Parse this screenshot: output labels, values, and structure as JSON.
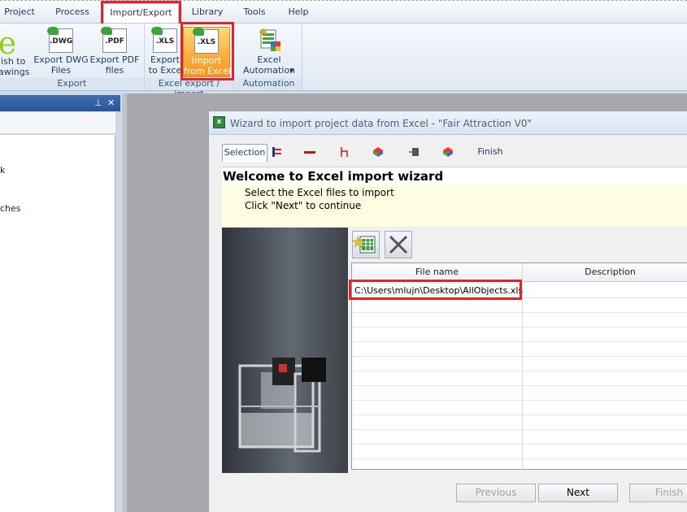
{
  "menu": {
    "items": [
      "Project",
      "Process",
      "Import/Export",
      "Library",
      "Tools",
      "Help"
    ],
    "active": "Import/Export"
  },
  "ribbon": {
    "groups": {
      "export": {
        "label": "Export",
        "publish": "lish to\nawings",
        "dwg": {
          "label": "Export DWG\nFiles",
          "icon_text": ".DWG"
        },
        "pdf": {
          "label": "Export PDF\nfiles",
          "icon_text": ".PDF"
        }
      },
      "excel": {
        "label": "Excel export / import",
        "export_excel": {
          "label": "Export\nto Exce",
          "icon_text": ".XLS"
        },
        "import_excel": {
          "label": "Import\nfrom Excel",
          "icon_text": ".XLS"
        }
      },
      "automation": {
        "label": "Automation",
        "excel_automation": {
          "label": "Excel\nAutomation"
        }
      }
    }
  },
  "left_panel": {
    "pin_glyph": "⊥",
    "close_glyph": "✕",
    "items": [
      "k",
      "ches"
    ]
  },
  "dialog": {
    "title": "Wizard to import project data from Excel - \"Fair Attraction V0\"",
    "tabs": {
      "selection": "Selection",
      "finish": "Finish"
    },
    "heading": "Welcome to Excel import wizard",
    "instructions": [
      "Select the Excel files to import",
      "Click \"Next\" to continue"
    ],
    "grid": {
      "columns": [
        "File name",
        "Description"
      ],
      "rows": [
        {
          "file_name": "C:\\Users\\mlujn\\Desktop\\AllObjects.xls",
          "description": ""
        }
      ]
    },
    "buttons": {
      "previous": "Previous",
      "next": "Next",
      "finish": "Finish"
    }
  },
  "colors": {
    "highlight_red": "#e0242b",
    "ribbon_active_orange": "#fbb040",
    "title_blue": "#2a5597"
  }
}
